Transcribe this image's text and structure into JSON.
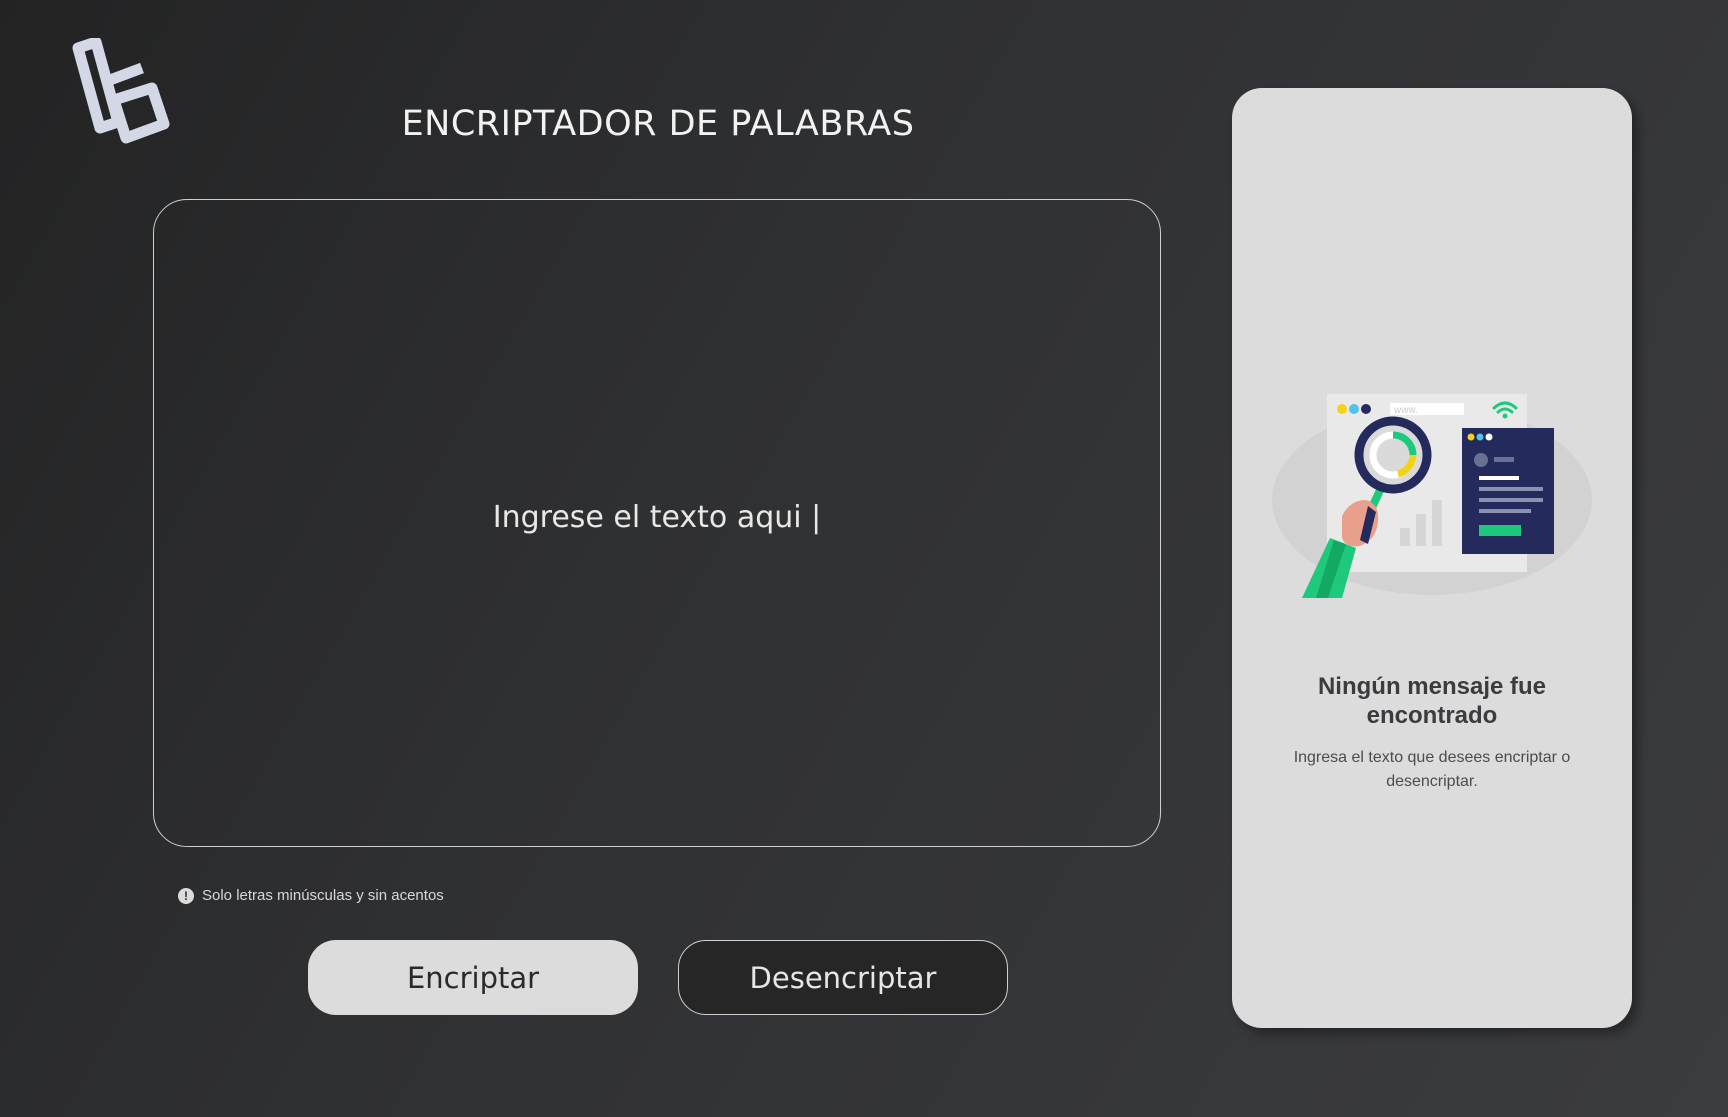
{
  "header": {
    "title": "ENCRIPTADOR DE PALABRAS",
    "logo_icon": "alura-logo-icon"
  },
  "input": {
    "placeholder": "Ingrese el texto aqui |",
    "value": ""
  },
  "hint": {
    "icon": "info-icon",
    "text": "Solo letras minúsculas y sin acentos"
  },
  "buttons": {
    "encrypt_label": "Encriptar",
    "decrypt_label": "Desencriptar"
  },
  "output_panel": {
    "illustration": "magnifier-search-illustration",
    "illustration_url_text": "www.",
    "title": "Ningún mensaje fue encontrado",
    "message": "Ingresa el texto que desees encriptar o desencriptar."
  },
  "colors": {
    "background": "#2f3032",
    "panel": "#dcdcdc",
    "accent_green": "#1ec97e",
    "navy": "#252a5c",
    "yellow": "#f5d21a",
    "skin": "#e8a08c"
  }
}
